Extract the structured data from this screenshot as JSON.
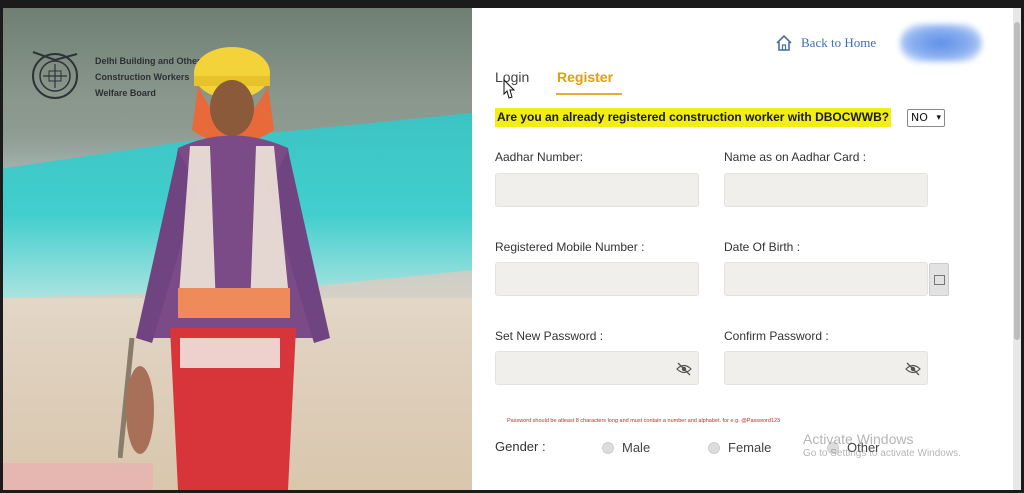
{
  "brand": {
    "org_line1": "Delhi Building and Other",
    "org_line2": "Construction Workers",
    "org_line3": "Welfare Board"
  },
  "header": {
    "back_home_label": "Back to Home",
    "home_icon": "home-icon"
  },
  "tabs": [
    {
      "label": "Login",
      "active": false
    },
    {
      "label": "Register",
      "active": true
    }
  ],
  "question": {
    "text": "Are you an already registered construction worker with DBOCWWB?",
    "selected": "NO"
  },
  "form": {
    "aadhar_number_label": "Aadhar Number:",
    "name_label": "Name as on Aadhar Card :",
    "mobile_label": "Registered Mobile Number :",
    "dob_label": "Date Of Birth :",
    "new_password_label": "Set New Password :",
    "confirm_password_label": "Confirm Password :",
    "password_hint": "Password should be atleast 8 characters long and must contain a number and alphabet. for e.g. @Password123",
    "gender_label": "Gender :",
    "gender_options": [
      "Male",
      "Female",
      "Other"
    ]
  },
  "watermark": {
    "line1": "Activate Windows",
    "line2": "Go to Settings to activate Windows."
  },
  "colors": {
    "accent": "#e0a100",
    "question_highlight": "#f3ee12",
    "link": "#3b6fb6",
    "hint": "#cc2a2a"
  }
}
